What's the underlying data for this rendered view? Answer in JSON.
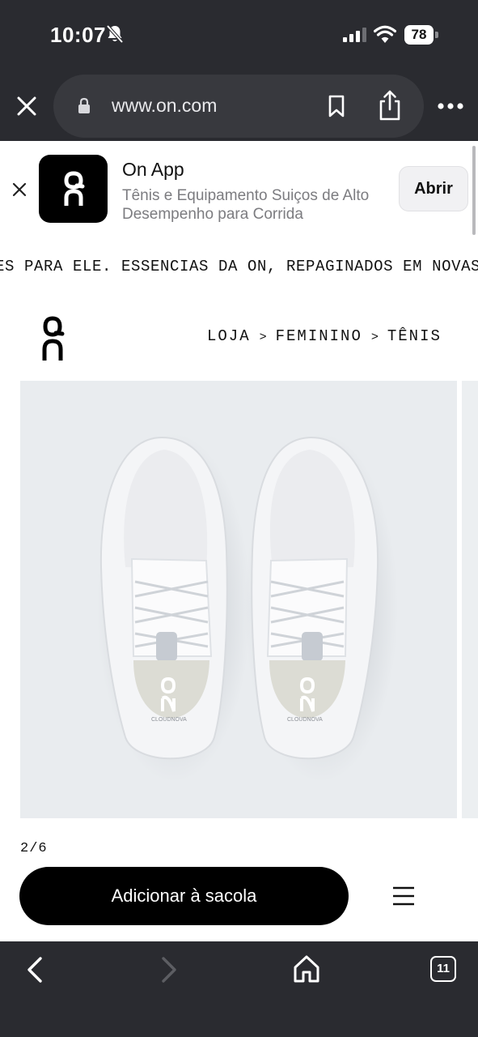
{
  "status_bar": {
    "time": "10:07",
    "battery": "78",
    "icons": [
      "bell-slash-icon",
      "signal-icon",
      "wifi-icon",
      "battery-icon"
    ]
  },
  "browser": {
    "url": "www.on.com",
    "icons": [
      "close-icon",
      "lock-icon",
      "bookmark-icon",
      "share-icon",
      "more-icon"
    ]
  },
  "app_banner": {
    "title": "On App",
    "subtitle": "Tênis e Equipamento Suiços de Alto Desempenho para Corrida",
    "open_label": "Abrir"
  },
  "ticker": {
    "text": "ES PARA ELE. ESSENCIAS DA ON, REPAGINADOS EM NOVAS"
  },
  "breadcrumb": {
    "items": [
      "LOJA",
      "FEMININO",
      "TÊNIS"
    ],
    "separator": ">"
  },
  "product": {
    "image_label": "CLOUDNOVA",
    "counter": "2/6",
    "add_to_bag_label": "Adicionar à sacola"
  },
  "toolbar": {
    "tab_count": "11",
    "icons": [
      "back-icon",
      "forward-icon",
      "home-icon",
      "tabs-icon"
    ]
  },
  "colors": {
    "chrome": "#2a2b30",
    "url_pill": "#38393e",
    "primary_button": "#000000",
    "image_bg": "#e9ecef"
  }
}
